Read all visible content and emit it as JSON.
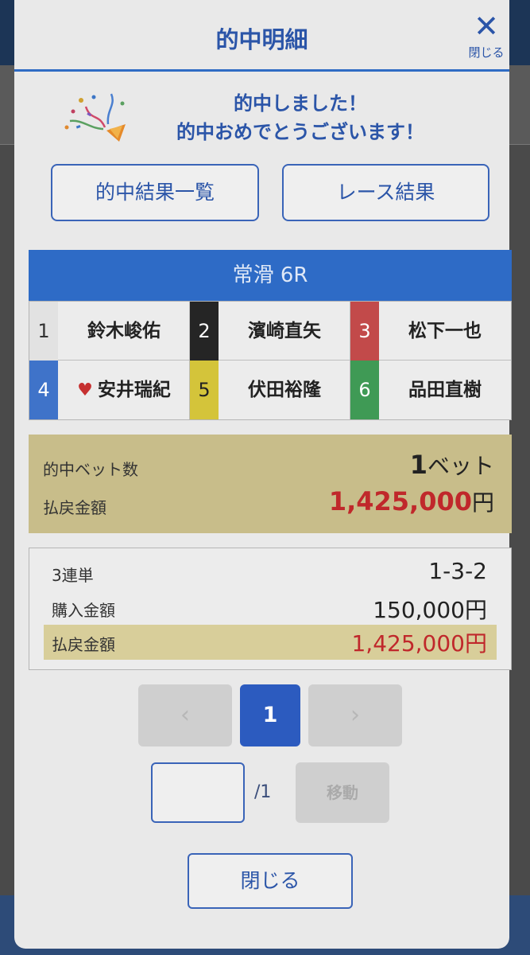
{
  "modal": {
    "title": "的中明細",
    "close_label": "閉じる"
  },
  "congrats": {
    "line1": "的中しました！",
    "line2": "的中おめでとうございます！"
  },
  "buttons": {
    "hit_results": "的中結果一覧",
    "race_results": "レース結果"
  },
  "race": {
    "title": "常滑 6R",
    "racers": [
      {
        "num": "1",
        "name": "鈴木峻佑",
        "color": "#e2e2e2",
        "text_color": "#333333",
        "favorite": false
      },
      {
        "num": "2",
        "name": "濱崎直矢",
        "color": "#252525",
        "text_color": "#ffffff",
        "favorite": false
      },
      {
        "num": "3",
        "name": "松下一也",
        "color": "#c24a4a",
        "text_color": "#ffffff",
        "favorite": false
      },
      {
        "num": "4",
        "name": "安井瑞紀",
        "color": "#3f73c9",
        "text_color": "#ffffff",
        "favorite": true
      },
      {
        "num": "5",
        "name": "伏田裕隆",
        "color": "#d4c43a",
        "text_color": "#222222",
        "favorite": false
      },
      {
        "num": "6",
        "name": "品田直樹",
        "color": "#3f9a55",
        "text_color": "#ffffff",
        "favorite": false
      }
    ]
  },
  "summary": {
    "bet_count_label": "的中ベット数",
    "bet_count_value": "1",
    "bet_count_unit": "ベット",
    "payout_label": "払戻金額",
    "payout_value": "1,425,000",
    "payout_unit": "円"
  },
  "detail": {
    "bet_type": "3連単",
    "combination": "1-3-2",
    "purchase_label": "購入金額",
    "purchase_value": "150,000円",
    "payout_label": "払戻金額",
    "payout_value": "1,425,000円"
  },
  "pager": {
    "prev": "‹",
    "current": "1",
    "next": "›",
    "total": "/1",
    "move_label": "移動"
  },
  "footer": {
    "close_label": "閉じる"
  },
  "colors": {
    "accent": "#2b55a8",
    "payout_red": "#c0282b",
    "summary_bg": "#c8bd8a"
  }
}
